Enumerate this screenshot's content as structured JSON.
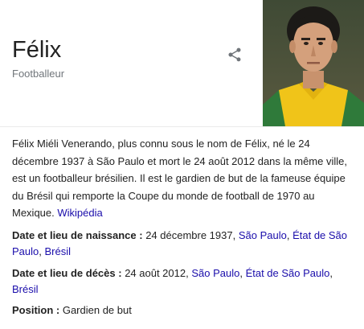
{
  "entity": {
    "name": "Félix",
    "subtitle": "Footballeur",
    "share_icon": "share-icon",
    "photo_alt": "Félix"
  },
  "description": {
    "text": "Félix Miéli Venerando, plus connu sous le nom de Félix, né le 24 décembre 1937 à São Paulo et mort le 24 août 2012 dans la même ville, est un footballeur brésilien. Il est le gardien de but de la fameuse équipe du Brésil qui remporte la Coupe du monde de football de 1970 au Mexique.",
    "source_link": "Wikipédia"
  },
  "facts": {
    "birth": {
      "label": "Date et lieu de naissance",
      "date": "24 décembre 1937",
      "places": [
        "São Paulo",
        "État de São Paulo",
        "Brésil"
      ]
    },
    "death": {
      "label": "Date et lieu de décès",
      "date": "24 août 2012",
      "places": [
        "São Paulo",
        "État de São Paulo",
        "Brésil"
      ]
    },
    "position": {
      "label": "Position",
      "value": "Gardien de but"
    }
  },
  "colors": {
    "link": "#1a0dab",
    "text": "#222222",
    "subtle": "#70757a",
    "jersey_yellow": "#f0c419",
    "jersey_green": "#2f7a3a"
  }
}
